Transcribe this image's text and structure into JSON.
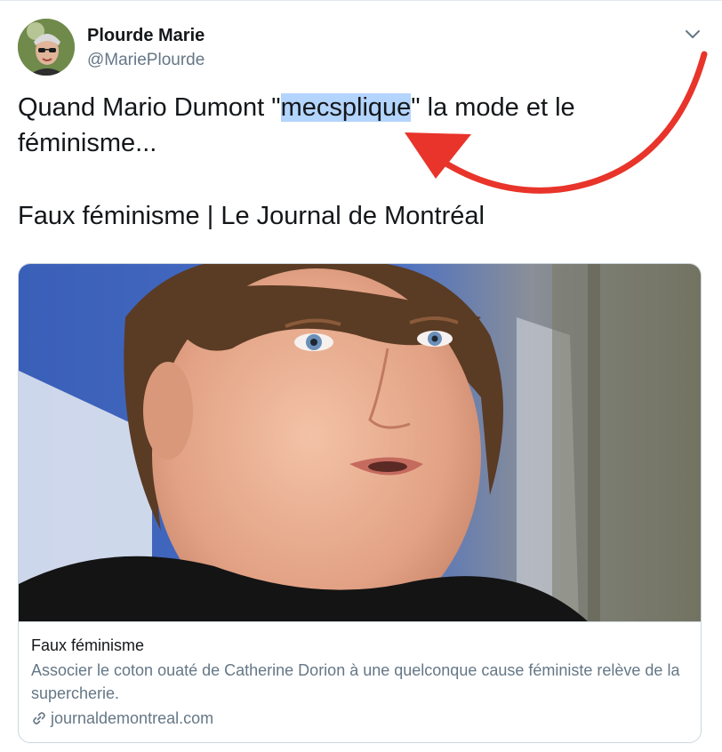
{
  "tweet": {
    "author_name": "Plourde Marie",
    "author_handle": "@MariePlourde",
    "text_before_highlight": "Quand Mario Dumont \"",
    "text_highlight": "mecsplique",
    "text_after_highlight": "\" la mode et le",
    "text_line2": "féminisme...",
    "link_headline": "Faux féminisme | Le Journal de Montréal"
  },
  "preview": {
    "title": "Faux féminisme",
    "description": "Associer le coton ouaté de Catherine Dorion à une quelconque cause féministe relève de la supercherie.",
    "domain": "journaldemontreal.com",
    "domain_icon": "link-icon"
  },
  "icons": {
    "menu": "chevron-down-icon",
    "annotation": "red-arrow"
  },
  "colors": {
    "highlight": "#b3d4fc",
    "annotation_arrow": "#e8342a",
    "secondary_text": "#657786",
    "caret": "#657786"
  }
}
